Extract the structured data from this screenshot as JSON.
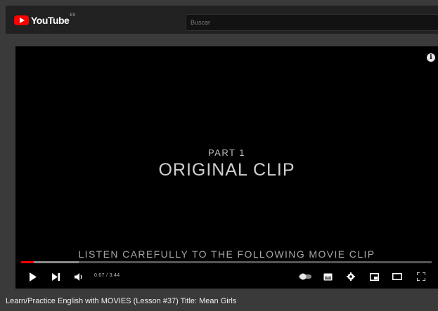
{
  "masthead": {
    "logo_text": "YouTube",
    "region_code": "ES",
    "search_placeholder": "Buscar"
  },
  "player": {
    "part_label": "PART 1",
    "clip_title": "ORIGINAL CLIP",
    "subtitle": "LISTEN CAREFULLY TO THE FOLLOWING MOVIE CLIP",
    "time_display": "0:07 / 3:44",
    "progress_played_fraction": 0.03,
    "progress_buffered_fraction": 0.14,
    "colors": {
      "progress_played": "#ff0000",
      "background": "#000000"
    },
    "icons": [
      "play-icon",
      "next-icon",
      "volume-icon",
      "autoplay-toggle-icon",
      "subtitles-icon",
      "settings-icon",
      "miniplayer-icon",
      "theater-icon",
      "fullscreen-icon",
      "info-icon"
    ]
  },
  "video": {
    "title": "Learn/Practice English with MOVIES (Lesson #37) Title: Mean Girls"
  }
}
